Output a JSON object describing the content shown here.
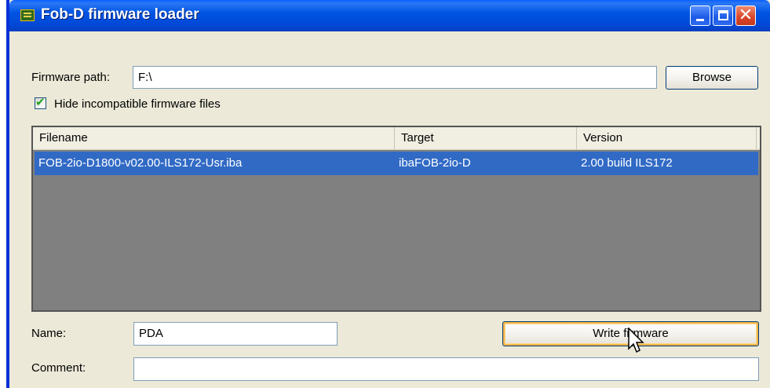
{
  "window": {
    "title": "Fob-D firmware loader",
    "icon": "chip-icon",
    "controls": {
      "minimize": "minimize-icon",
      "maximize": "maximize-icon",
      "close": "close-icon"
    }
  },
  "firmware_path": {
    "label": "Firmware path:",
    "value": "F:\\"
  },
  "browse_label": "Browse",
  "hide_incompatible": {
    "label": "Hide incompatible firmware files",
    "checked": true
  },
  "file_list": {
    "columns": [
      "Filename",
      "Target",
      "Version"
    ],
    "rows": [
      {
        "filename": "FOB-2io-D1800-v02.00-ILS172-Usr.iba",
        "target": "ibaFOB-2io-D",
        "version": "2.00 build ILS172",
        "selected": true
      }
    ]
  },
  "name": {
    "label": "Name:",
    "value": "PDA"
  },
  "comment": {
    "label": "Comment:",
    "value": ""
  },
  "write_label": "Write firmware",
  "colors": {
    "title_bar": "#0054e3",
    "selection": "#316ac5",
    "list_background": "#808080",
    "face": "#ece9d8"
  }
}
